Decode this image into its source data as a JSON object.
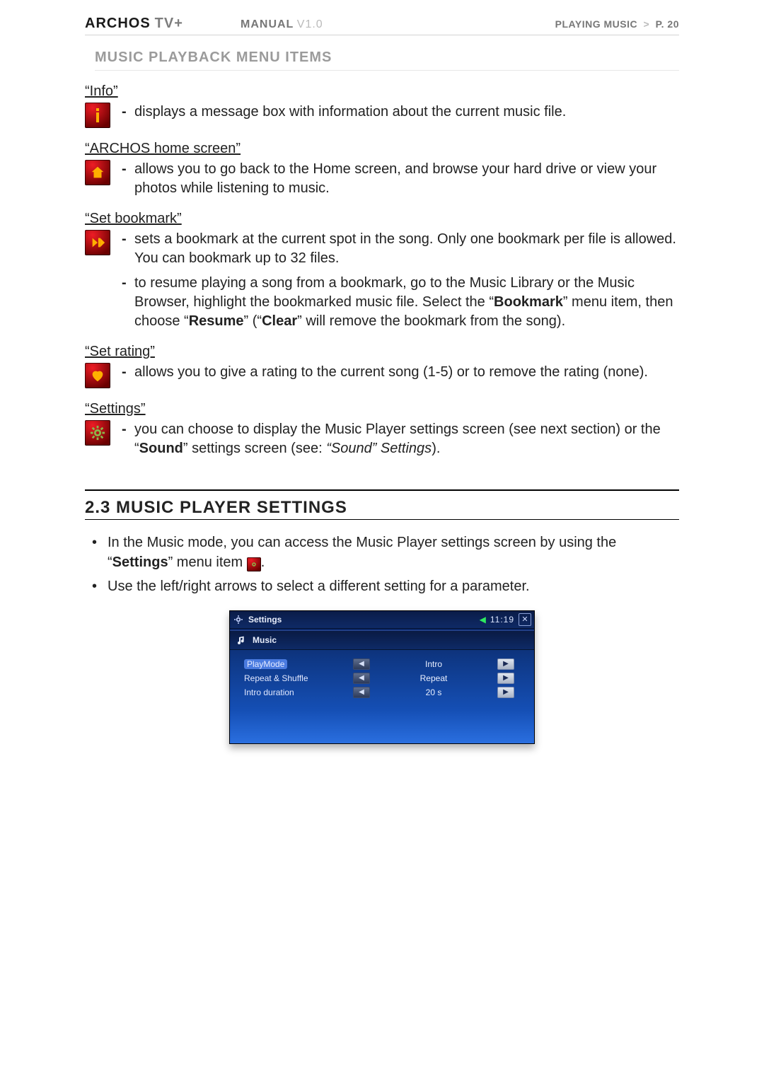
{
  "header": {
    "brand_main": "ARCHOS",
    "brand_sub": "TV+",
    "manual_label": "MANUAL",
    "manual_version": "V1.0",
    "crumb_section": "PLAYING MUSIC",
    "crumb_sep": ">",
    "page_label": "P.",
    "page_number": "20"
  },
  "subsection_title": "MUSIC PLAYBACK MENU ITEMS",
  "items": {
    "info": {
      "title": "“Info”",
      "line1": "displays a message box with information about the current music file."
    },
    "home": {
      "title": "“ARCHOS home screen”",
      "line1": "allows you to go back to the Home screen, and browse your hard drive or view your photos while listening to music."
    },
    "bookmark": {
      "title": "“Set bookmark”",
      "line1": "sets a bookmark at the current spot in the song. Only one bookmark per file is allowed. You can bookmark up to 32 files.",
      "line2_pre": "to resume playing a song from a bookmark, go to the Music Library or the Music Browser, highlight the bookmarked music file. Select the “",
      "line2_b1": "Bookmark",
      "line2_mid1": "” menu item, then choose “",
      "line2_b2": "Resume",
      "line2_mid2": "” (“",
      "line2_b3": "Clear",
      "line2_post": "” will remove the bookmark from the song)."
    },
    "rating": {
      "title": "“Set rating”",
      "line1": "allows you to give a rating to the current song (1-5) or to remove the rating (none)."
    },
    "settings": {
      "title": "“Settings”",
      "line1_pre": "you can choose to display the Music Player settings screen (see next section) or the “",
      "line1_b1": "Sound",
      "line1_mid": "” settings screen (see: ",
      "line1_i1": "“Sound” Settings",
      "line1_post": ")."
    }
  },
  "section23": {
    "heading": "2.3 MUSIC PLAYER SETTINGS",
    "b1_pre": "In the Music mode, you can access the Music Player settings screen by using the “",
    "b1_bold": "Settings",
    "b1_post": "” menu item ",
    "b1_tail": ".",
    "b2": "Use the left/right arrows to select a different setting for a parameter."
  },
  "screenshot": {
    "title": "Settings",
    "clock": "11:19",
    "category": "Music",
    "rows": [
      {
        "label": "PlayMode",
        "value": "Intro",
        "selected": true
      },
      {
        "label": "Repeat & Shuffle",
        "value": "Repeat",
        "selected": false
      },
      {
        "label": "Intro duration",
        "value": "20 s",
        "selected": false
      }
    ]
  }
}
